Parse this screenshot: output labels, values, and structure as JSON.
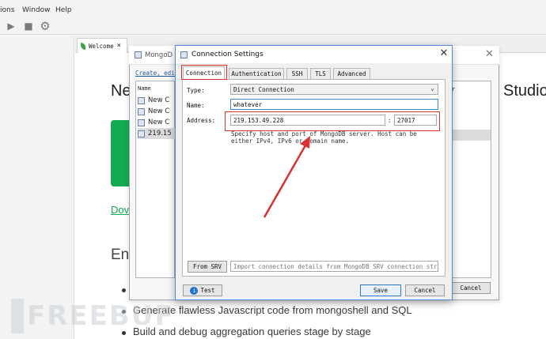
{
  "menu": {
    "items": [
      "ions",
      "Window",
      "Help"
    ]
  },
  "toolbar": {
    "icons": [
      "run-icon",
      "stop-icon",
      "gear-icon"
    ]
  },
  "editor_tab": {
    "label": "Welcome",
    "close": "×"
  },
  "welcome": {
    "heading_partial": "Ne",
    "heading_right": "Studio",
    "download_partial": "Dov",
    "section_partial": "En",
    "bullets": [
      "Generate flawless Javascript code from mongoshell and SQL",
      "Build and debug aggregation queries stage by stage"
    ]
  },
  "connection_manager": {
    "title_partial": "MongoD",
    "links_partial": "Create, edit",
    "list_header": "Name",
    "list_header_right": "r",
    "rows": [
      "New C",
      "New C",
      "New C",
      "219.15"
    ],
    "cancel_label": "Cancel"
  },
  "dialog": {
    "title": "Connection Settings",
    "close": "✕",
    "tabs": [
      "Connection",
      "Authentication",
      "SSH",
      "TLS",
      "Advanced"
    ],
    "type_label": "Type:",
    "type_value": "Direct Connection",
    "name_label": "Name:",
    "name_value": "whatever",
    "address_label": "Address:",
    "address_host": "219.153.49.228",
    "address_sep": ":",
    "address_port": "27017",
    "hint": "Specify host and port of MongoDB server. Host can be either IPv4, IPv6 or domain name.",
    "from_srv_label": "From SRV",
    "srv_placeholder": "Import connection details from MongoDB SRV connection string",
    "test_label": "Test",
    "save_label": "Save",
    "cancel_label": "Cancel"
  },
  "annotation_colors": {
    "highlight": "#d93030",
    "accent": "#2b7bd6",
    "brand_green": "#13aa52"
  },
  "watermark": {
    "text": "FREEBUF"
  }
}
